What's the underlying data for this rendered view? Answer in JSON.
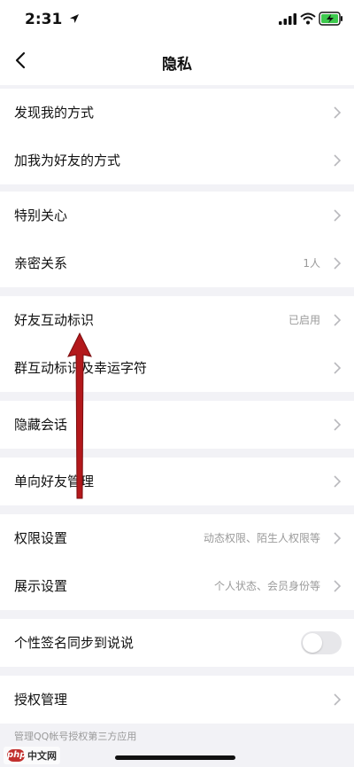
{
  "status_bar": {
    "time": "2:31"
  },
  "nav": {
    "title": "隐私"
  },
  "groups": [
    [
      {
        "label": "发现我的方式"
      },
      {
        "label": "加我为好友的方式"
      }
    ],
    [
      {
        "label": "特别关心"
      },
      {
        "label": "亲密关系",
        "value": "1人"
      }
    ],
    [
      {
        "label": "好友互动标识",
        "value": "已启用"
      },
      {
        "label": "群互动标识及幸运字符"
      }
    ],
    [
      {
        "label": "隐藏会话"
      }
    ],
    [
      {
        "label": "单向好友管理"
      }
    ],
    [
      {
        "label": "权限设置",
        "value": "动态权限、陌生人权限等"
      },
      {
        "label": "展示设置",
        "value": "个人状态、会员身份等"
      }
    ],
    [
      {
        "label": "个性签名同步到说说",
        "toggle": false
      }
    ],
    [
      {
        "label": "授权管理"
      }
    ]
  ],
  "footer_note": "管理QQ帐号授权第三方应用",
  "watermark": {
    "badge": "php",
    "text": "中文网"
  },
  "colors": {
    "annotation_arrow": "#b3181b",
    "page_bg": "#f2f2f6"
  }
}
